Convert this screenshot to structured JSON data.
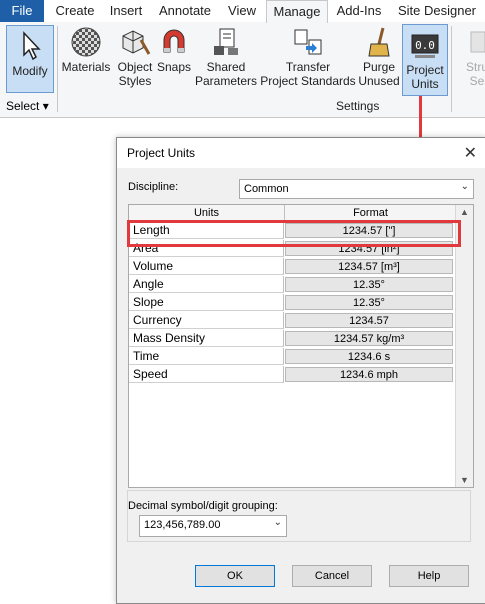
{
  "ribbon": {
    "tabs": [
      "File",
      "Create",
      "Insert",
      "Annotate",
      "View",
      "Manage",
      "Add-Ins",
      "Site Designer"
    ],
    "active_tab": "Manage",
    "modify_label": "Modify",
    "select_label": "Select",
    "buttons": {
      "materials": "Materials",
      "object_styles_1": "Object",
      "object_styles_2": "Styles",
      "snaps": "Snaps",
      "shared_params_1": "Shared",
      "shared_params_2": "Parameters",
      "transfer_1": "Transfer",
      "transfer_2": "Project Standards",
      "purge_1": "Purge",
      "purge_2": "Unused",
      "units_1": "Project",
      "units_2": "Units",
      "struct_1": "Stru",
      "struct_2": "Se"
    },
    "settings_panel_label": "Settings"
  },
  "dialog": {
    "title": "Project Units",
    "discipline_label": "Discipline:",
    "discipline_value": "Common",
    "columns": {
      "units": "Units",
      "format": "Format"
    },
    "rows": [
      {
        "unit": "Length",
        "format": "1234.57 [\"]"
      },
      {
        "unit": "Area",
        "format": "1234.57 [in²]"
      },
      {
        "unit": "Volume",
        "format": "1234.57 [m³]"
      },
      {
        "unit": "Angle",
        "format": "12.35°"
      },
      {
        "unit": "Slope",
        "format": "12.35°"
      },
      {
        "unit": "Currency",
        "format": "1234.57"
      },
      {
        "unit": "Mass Density",
        "format": "1234.57 kg/m³"
      },
      {
        "unit": "Time",
        "format": "1234.6 s"
      },
      {
        "unit": "Speed",
        "format": "1234.6 mph"
      }
    ],
    "decimal_label": "Decimal symbol/digit grouping:",
    "decimal_value": "123,456,789.00",
    "ok": "OK",
    "cancel": "Cancel",
    "help": "Help"
  },
  "colors": {
    "accent_red": "#e0393e",
    "file_tab": "#1f5fa8",
    "selected_tool": "#c8def5"
  }
}
